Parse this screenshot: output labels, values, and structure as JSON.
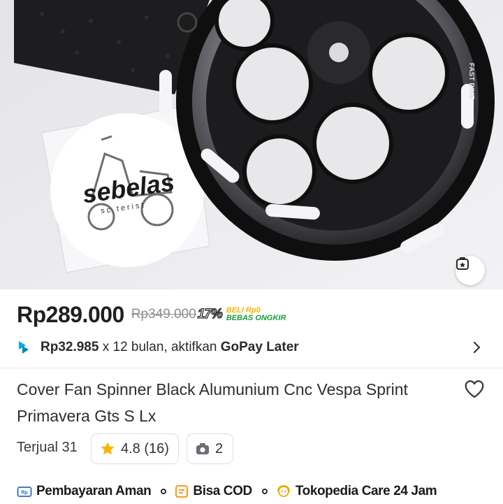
{
  "product_image": {
    "sticker_brand": "sebelas",
    "sticker_sub": "sc   terist",
    "cover_text": "FAST BIKE",
    "ar_icon": "camera-ar-icon"
  },
  "price": {
    "current": "Rp289.000",
    "original": "Rp349.000",
    "discount": "17%",
    "promo_line1": "BELI Rp0",
    "promo_line2": "BEBAS ONGKIR"
  },
  "gopay": {
    "icon": "gopay-icon",
    "amount": "Rp32.985",
    "text": " x 12 bulan, aktifkan ",
    "brand": "GoPay Later"
  },
  "product": {
    "title": "Cover Fan Spinner Black Alumunium Cnc Vespa Sprint Primavera Gts S Lx",
    "sold": "Terjual 31",
    "rating": "4.8 (16)",
    "photos": "2"
  },
  "benefits": [
    {
      "label": "Pembayaran Aman",
      "icon": "payment-icon"
    },
    {
      "label": "Bisa COD",
      "icon": "cod-icon"
    },
    {
      "label": "Tokopedia Care 24 Jam",
      "icon": "care-icon"
    }
  ],
  "colors": {
    "rating_star": "#f7b500",
    "gopay_blue": "#00aed6",
    "promo_green": "#1a9e3f",
    "promo_yellow": "#f7b500"
  }
}
